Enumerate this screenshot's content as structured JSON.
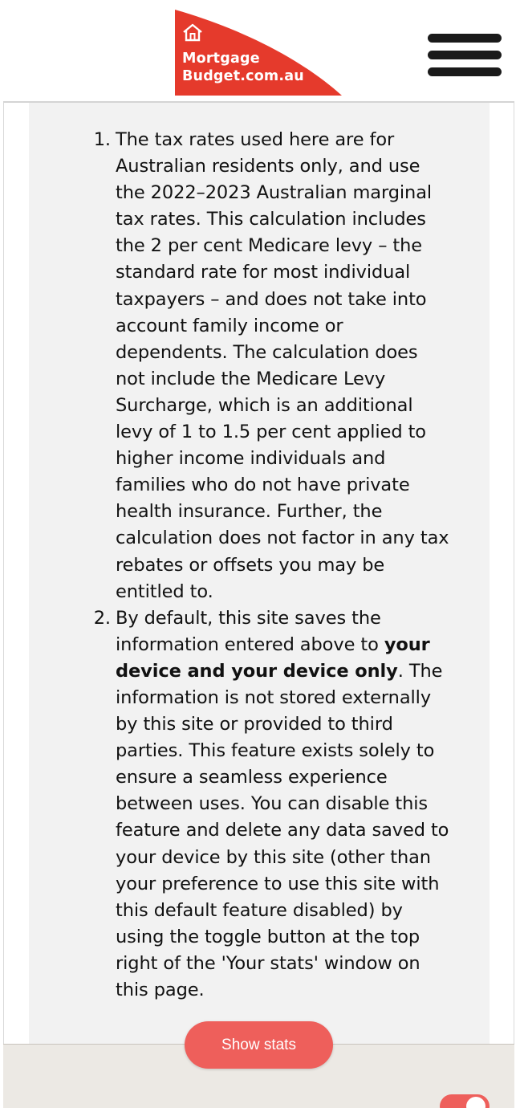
{
  "header": {
    "logo_line1": "Mortgage",
    "logo_line2": "Budget.com.au",
    "logo_icon": "house-icon",
    "menu_icon": "hamburger-menu-icon",
    "brand_color": "#e53a2c"
  },
  "notes": [
    {
      "number": "1.",
      "text": "The tax rates used here are for Australian residents only, and use the 2022–2023 Australian marginal tax rates. This calculation includes the 2 per cent Medicare levy – the standard rate for most individual taxpayers – and does not take into account family income or dependents. The calculation does not include the Medicare Levy Surcharge, which is an additional levy of 1 to 1.5 per cent applied to higher income individuals and families who do not have private health insurance. Further, the calculation does not factor in any tax rebates or offsets you may be entitled to."
    },
    {
      "number": "2.",
      "text_before": "By default, this site saves the information entered above to ",
      "text_bold": "your device and your device only",
      "text_after": ". The information is not stored externally by this site or provided to third parties. This feature exists solely to ensure a seamless experience between uses. You can disable this feature and delete any data saved to your device by this site (other than your preference to use this site with this default feature disabled) by using the toggle button at the top right of the 'Your stats' window on this page."
    }
  ],
  "footer": {
    "show_stats_label": "Show stats",
    "accent_color": "#ee5f5b",
    "toggle_state": "on"
  }
}
